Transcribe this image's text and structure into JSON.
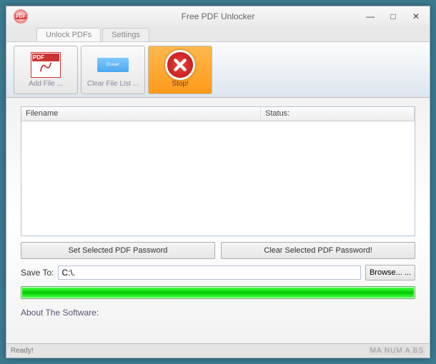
{
  "window": {
    "title": "Free PDF Unlocker",
    "minimize": "—",
    "maximize": "□",
    "close": "✕"
  },
  "tabs": {
    "unlock": "Unlock PDFs",
    "settings": "Settings"
  },
  "toolbar": {
    "addfile": "Add File ...",
    "clearlist": "Clear File List ...",
    "stop": "Stop!"
  },
  "list": {
    "col_filename": "Filename",
    "col_status": "Status:"
  },
  "buttons": {
    "set_pw": "Set Selected PDF Password",
    "clear_pw": "Clear Selected PDF Password!"
  },
  "save": {
    "label": "Save To:",
    "path": "C:\\.",
    "browse": "Browse... ..."
  },
  "about": "About The Software:",
  "status": {
    "ready": "Ready!",
    "indicators": "MA NUM A BS"
  }
}
